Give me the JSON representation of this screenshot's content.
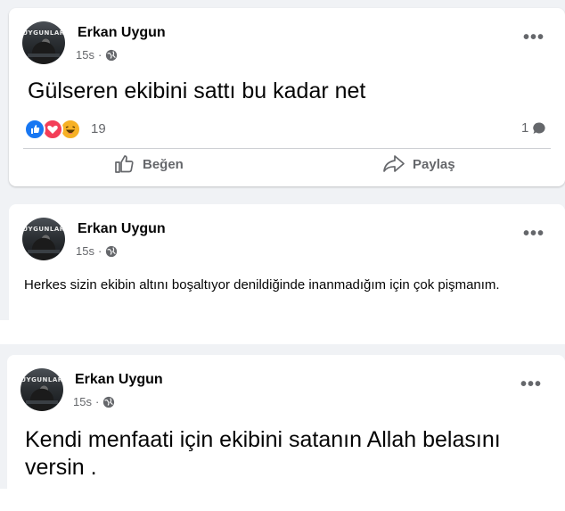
{
  "posts": [
    {
      "author": "Erkan Uygun",
      "time": "15s",
      "text": "Gülseren ekibini sattı bu kadar net",
      "reaction_count": "19",
      "comment_count": "1",
      "actions": {
        "like": "Beğen",
        "share": "Paylaş"
      }
    },
    {
      "author": "Erkan Uygun",
      "time": "15s",
      "text": "Herkes sizin ekibin altını boşaltıyor denildiğinde inanmadığım için çok pişmanım."
    },
    {
      "author": "Erkan Uygun",
      "time": "15s",
      "text": "Kendi menfaati için ekibini satanın Allah belasını versin ."
    }
  ],
  "avatar_text": "UYGUNLAR",
  "more_glyph": "•••",
  "icons": [
    "globe-icon",
    "more-options-icon",
    "like-reaction-icon",
    "love-reaction-icon",
    "haha-reaction-icon",
    "comment-icon",
    "thumbs-up-icon",
    "share-icon"
  ],
  "colors": {
    "background": "#f0f2f5",
    "card": "#ffffff",
    "secondary_text": "#65676b",
    "like_blue": "#1877f2",
    "love_red": "#f33e58",
    "haha_yellow": "#f7b125"
  }
}
